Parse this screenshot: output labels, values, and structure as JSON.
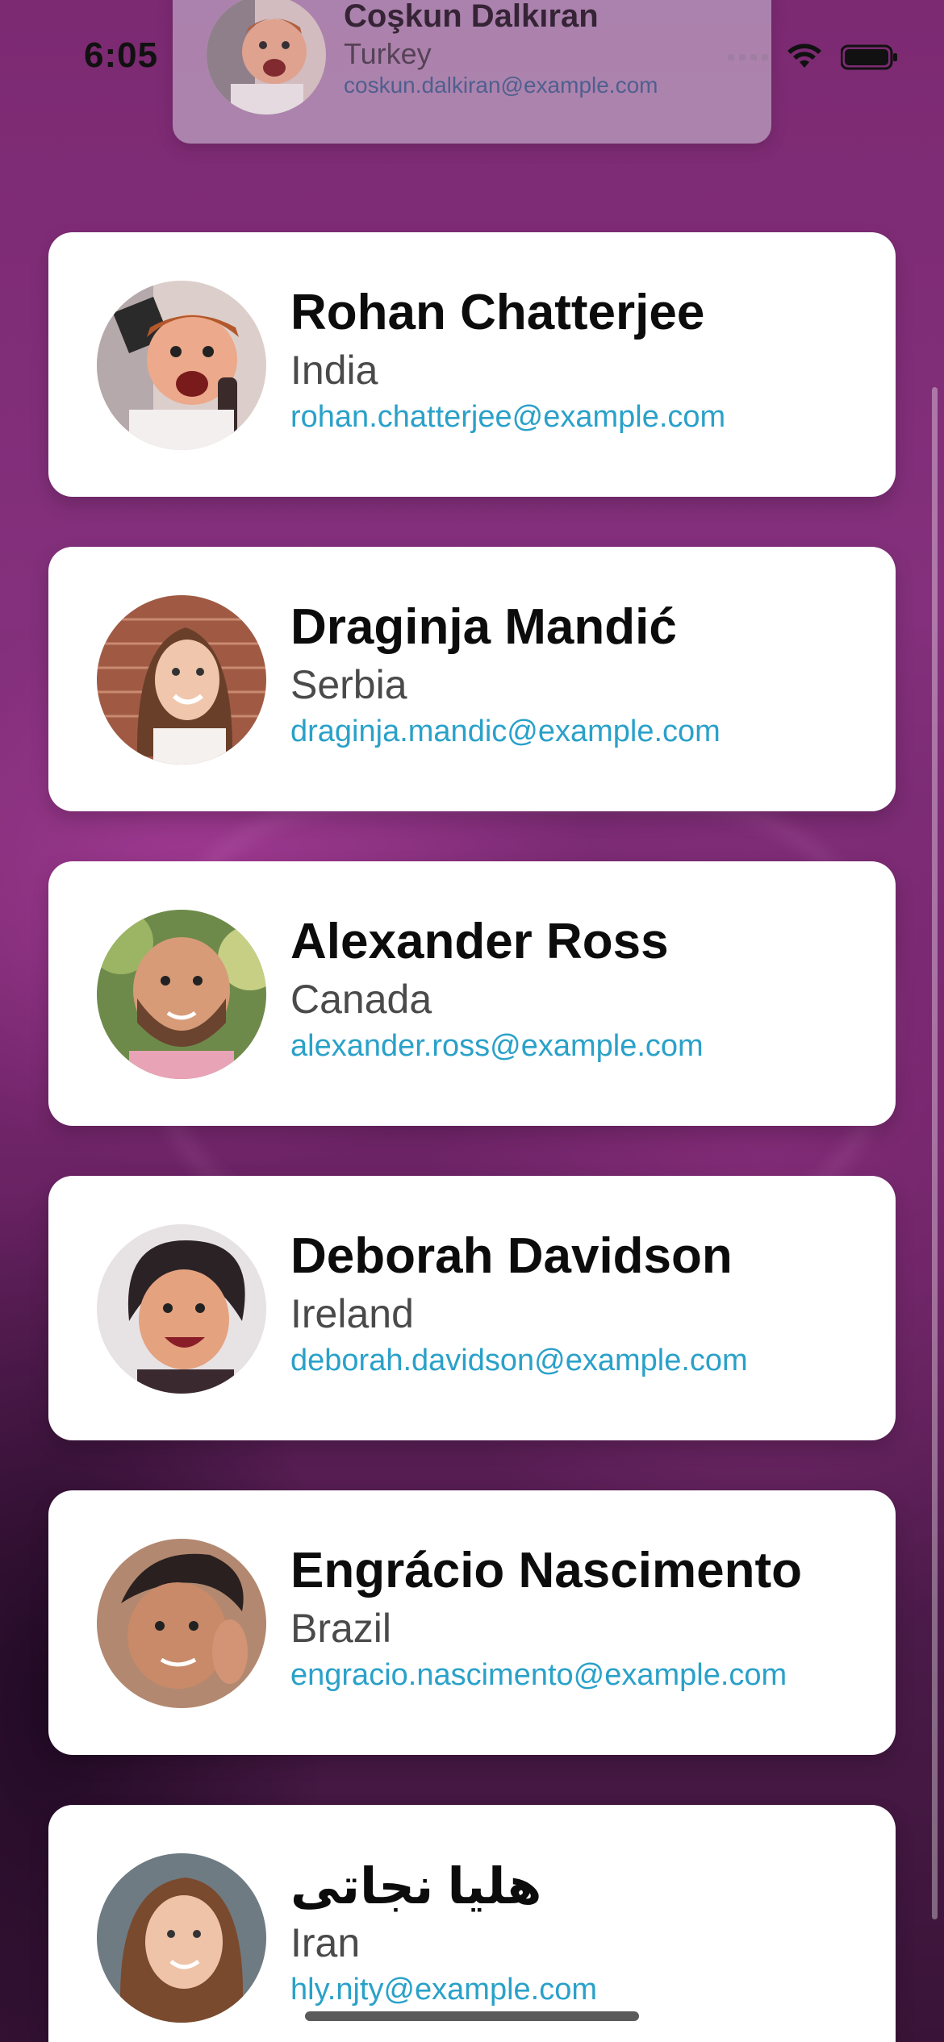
{
  "status_bar": {
    "time": "6:05"
  },
  "dragging_card": {
    "name": "Coşkun Dalkıran",
    "country": "Turkey",
    "email": "coskun.dalkiran@example.com"
  },
  "contacts": [
    {
      "name": "Rohan Chatterjee",
      "country": "India",
      "email": "rohan.chatterjee@example.com"
    },
    {
      "name": "Draginja Mandić",
      "country": "Serbia",
      "email": "draginja.mandic@example.com"
    },
    {
      "name": "Alexander Ross",
      "country": "Canada",
      "email": "alexander.ross@example.com"
    },
    {
      "name": "Deborah Davidson",
      "country": "Ireland",
      "email": "deborah.davidson@example.com"
    },
    {
      "name": "Engrácio Nascimento",
      "country": "Brazil",
      "email": "engracio.nascimento@example.com"
    },
    {
      "name": "هلیا نجاتی",
      "country": "Iran",
      "email": "hly.njty@example.com"
    }
  ],
  "colors": {
    "email": "#2aa1c9",
    "card": "#ffffff",
    "background": "#7c2a72"
  },
  "icons": [
    "wifi-icon",
    "battery-icon",
    "cellular-signal-icon"
  ]
}
